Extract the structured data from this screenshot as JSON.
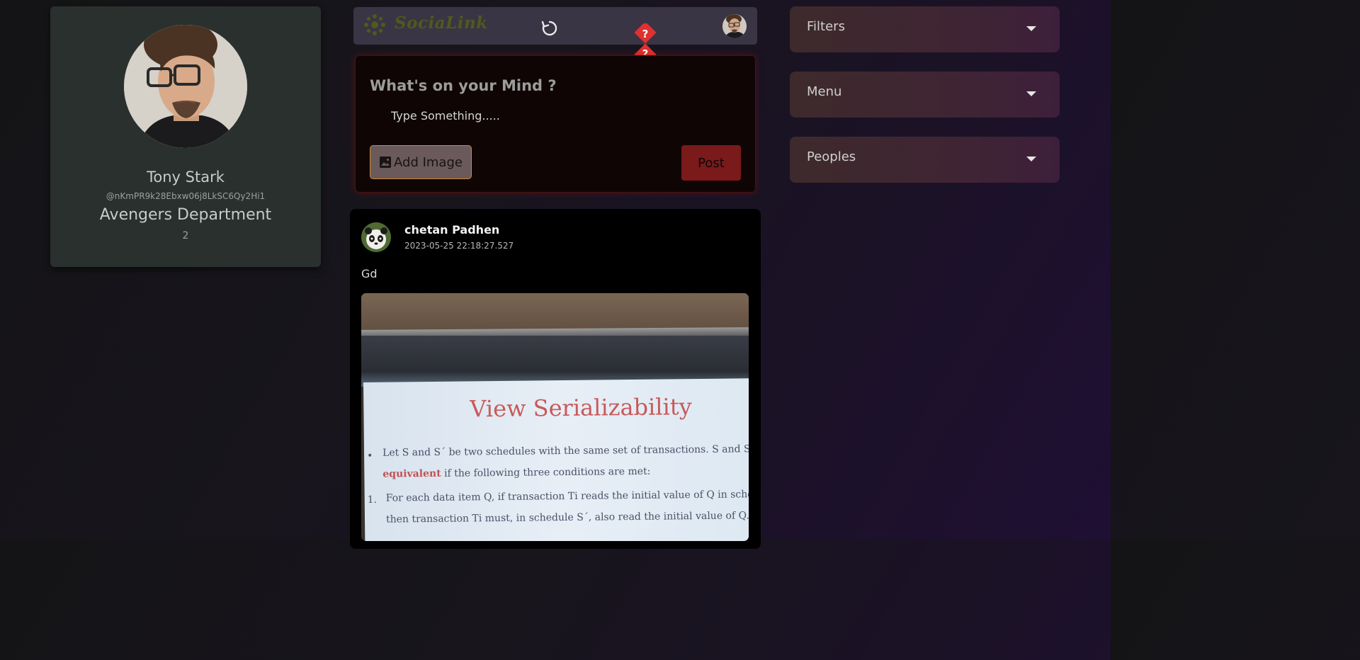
{
  "profile": {
    "name": "Tony Stark",
    "handle": "@nKmPR9k28Ebxw06j8LkSC6Qy2Hi1",
    "department": "Avengers Department",
    "count": "2"
  },
  "topbar": {
    "logo_text": "SociaLink",
    "logo_icon": "sparkle-icon",
    "refresh_icon": "refresh-icon",
    "help_icon": "question-diamond-icon"
  },
  "composer": {
    "title": "What's on your Mind ?",
    "input_placeholder": "Type Something.....",
    "input_value": "",
    "add_image_label": "Add Image",
    "add_image_icon": "image-icon",
    "post_label": "Post"
  },
  "post": {
    "author": "chetan Padhen",
    "timestamp": "2023-05-25 22:18:27.527",
    "text": "Gd",
    "image": {
      "slide_title": "View Serializability",
      "line1_pre": "Let S and S´ be two schedules with the same set of transactions.  S and S´ ar",
      "line2_bold": "equivalent",
      "line2_rest": " if the following three conditions are met:",
      "line3": "For each data item Q, if transaction Ti reads the initial value of Q in sche",
      "line4": "then transaction Ti  must, in schedule S´, also read the initial value of Q."
    }
  },
  "sidebar": {
    "accordions": [
      {
        "label": "Filters"
      },
      {
        "label": "Menu"
      },
      {
        "label": "Peoples"
      }
    ]
  },
  "colors": {
    "background": "#18151d",
    "profile_card": "#2a302d",
    "topbar": "#3a3544",
    "composer_bg": "#100505",
    "post_button": "#7a1a1a",
    "add_image_border": "#d48a2a",
    "accordion": "#3f2533",
    "help_marker": "#e03030"
  }
}
